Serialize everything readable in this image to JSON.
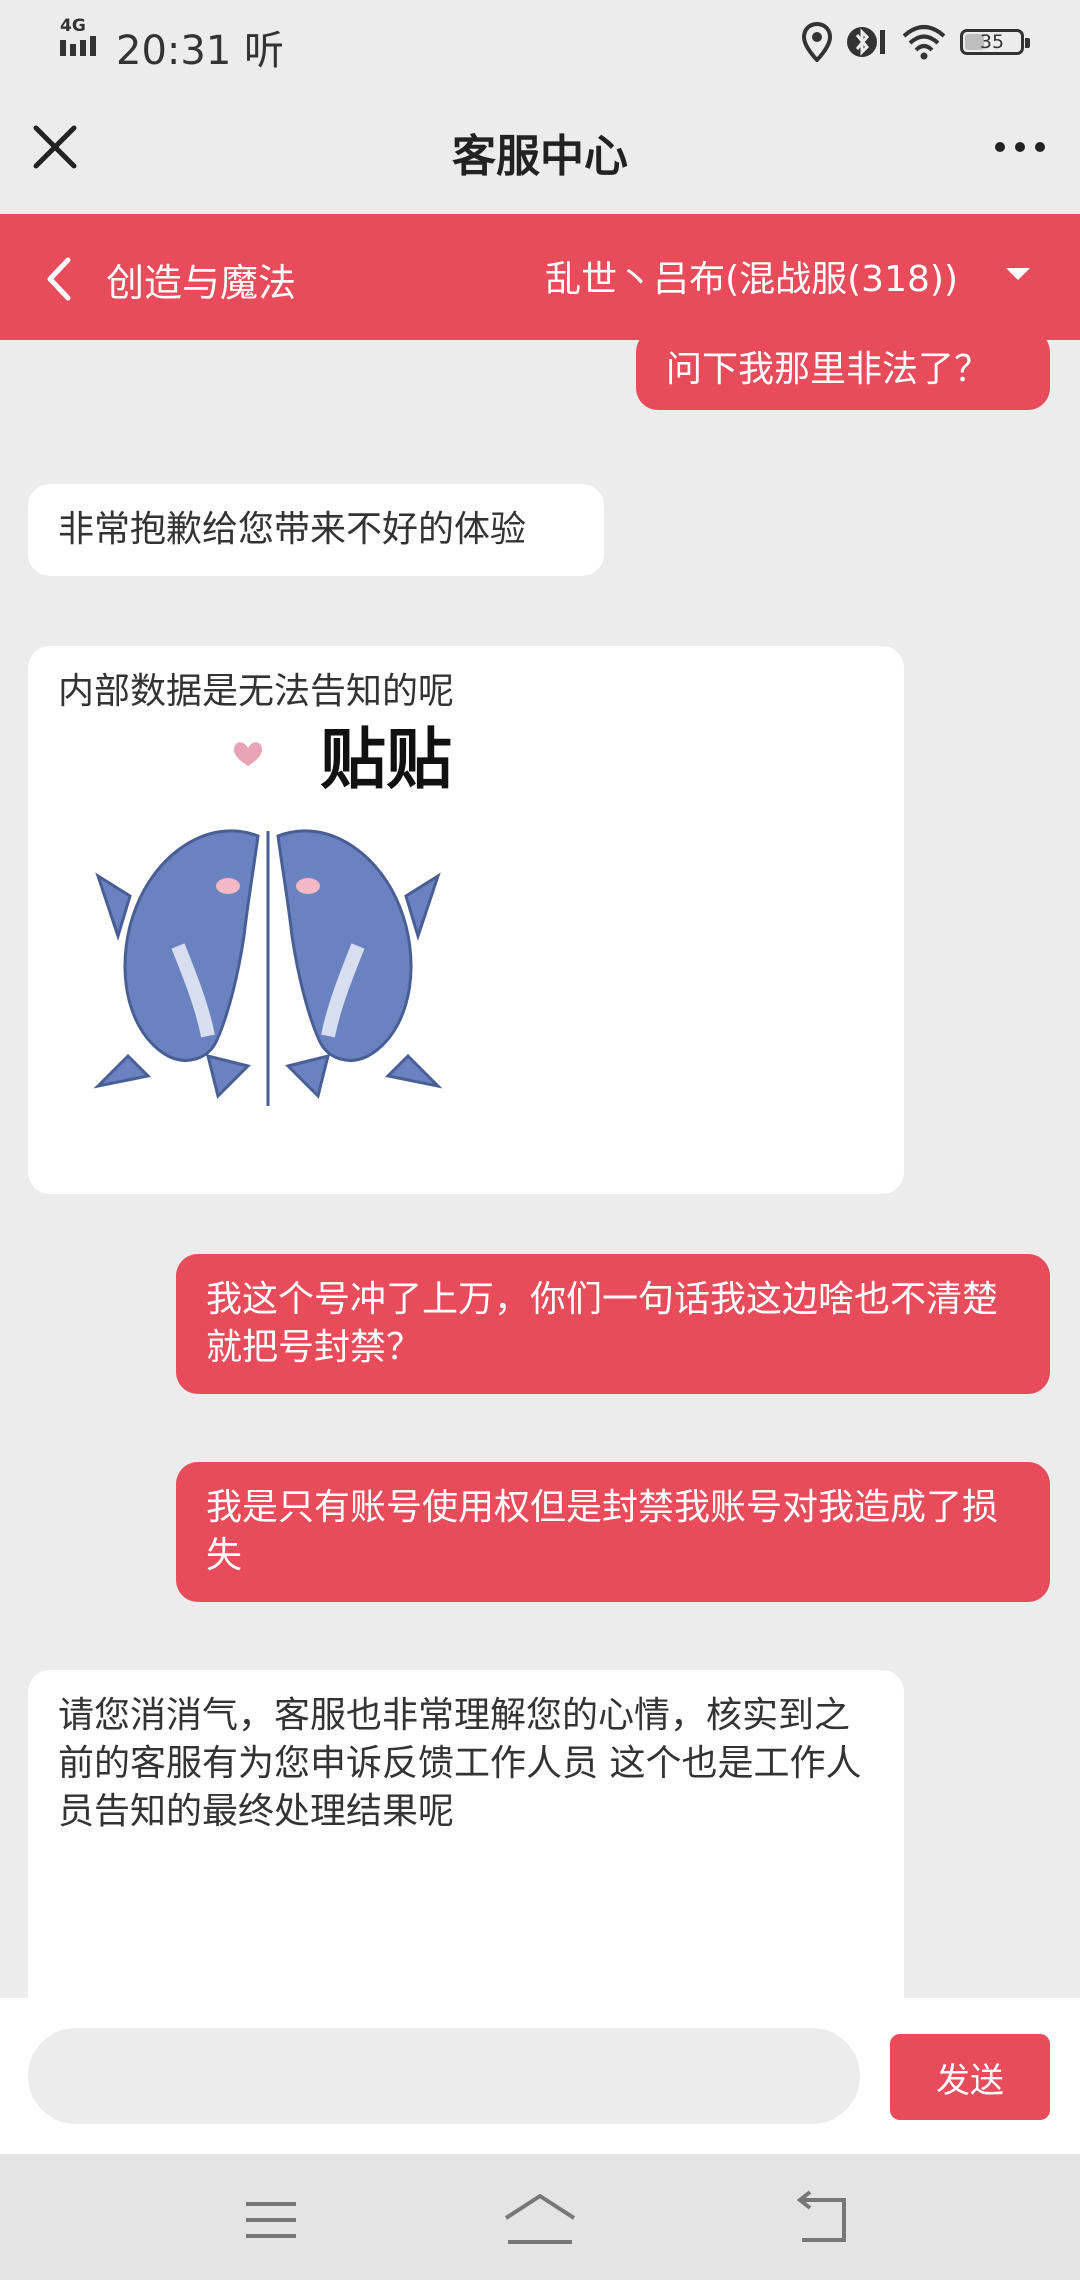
{
  "status_bar": {
    "network": "4G",
    "time": "20:31",
    "carrier_glyph": "听",
    "battery": "35",
    "battery_level": 0.35,
    "icons": [
      "signal-icon",
      "location-icon",
      "bluetooth-icon",
      "wifi-icon",
      "battery-icon"
    ]
  },
  "header": {
    "title": "客服中心",
    "close_icon": "close-icon",
    "more_icon": "more-icon"
  },
  "game_bar": {
    "game_name": "创造与魔法",
    "server": "乱世丶吕布(混战服(318))",
    "back_icon": "chevron-left-icon",
    "dropdown_icon": "caret-down-icon"
  },
  "messages": [
    {
      "from": "user",
      "text": "问下我那里非法了？"
    },
    {
      "from": "agent",
      "text": "非常抱歉给您带来不好的体验"
    },
    {
      "from": "agent",
      "text": "内部数据是无法告知的呢",
      "sticker_text": "贴贴"
    },
    {
      "from": "user",
      "text": "我这个号冲了上万，你们一句话我这边啥也不清楚就把号封禁？"
    },
    {
      "from": "user",
      "text": "我是只有账号使用权但是封禁我账号对我造成了损失"
    },
    {
      "from": "agent",
      "text": "请您消消气，客服也非常理解您的心情，核实到之前的客服有为您申诉反馈工作人员 这个也是工作人员告知的最终处理结果呢"
    }
  ],
  "input": {
    "value": "",
    "placeholder": "",
    "send_label": "发送"
  },
  "nav": {
    "icons": [
      "menu-icon",
      "home-icon",
      "back-icon"
    ]
  },
  "colors": {
    "accent": "#e84b5a",
    "background": "#ececec",
    "bubble_agent": "#ffffff"
  }
}
